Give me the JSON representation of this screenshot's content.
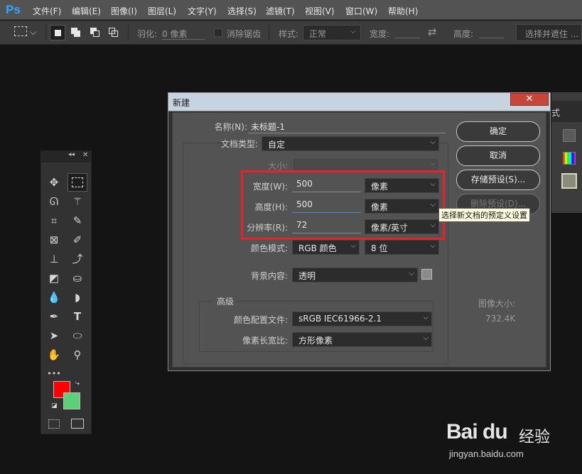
{
  "app": {
    "logo": "Ps"
  },
  "menu": [
    "文件(F)",
    "编辑(E)",
    "图像(I)",
    "图层(L)",
    "文字(Y)",
    "选择(S)",
    "滤镜(T)",
    "视图(V)",
    "窗口(W)",
    "帮助(H)"
  ],
  "options_bar": {
    "feather_label": "羽化:",
    "feather_value": "0 像素",
    "antialias_label": "消除锯齿",
    "style_label": "样式:",
    "style_value": "正常",
    "width_label": "宽度:",
    "height_label": "高度:",
    "select_mask_button": "选择并遮住 ..."
  },
  "dialog": {
    "title": "新建",
    "close_icon": "✕",
    "name_label": "名称(N):",
    "name_value": "未标题-1",
    "doc_type_label": "文档类型:",
    "doc_type_value": "自定",
    "size_label": "大小:",
    "width_label": "宽度(W):",
    "width_value": "500",
    "width_unit": "像素",
    "height_label": "高度(H):",
    "height_value": "500",
    "height_unit": "像素",
    "resolution_label": "分辨率(R):",
    "resolution_value": "72",
    "resolution_unit": "像素/英寸",
    "color_mode_label": "颜色模式:",
    "color_mode_value": "RGB 颜色",
    "bit_depth_value": "8 位",
    "background_label": "背景内容:",
    "background_value": "透明",
    "advanced_label": "高级",
    "color_profile_label": "颜色配置文件:",
    "color_profile_value": "sRGB IEC61966-2.1",
    "pixel_aspect_label": "像素长宽比:",
    "pixel_aspect_value": "方形像素",
    "ok_button": "确定",
    "cancel_button": "取消",
    "save_preset_button": "存储预设(S)...",
    "delete_preset_button": "删除预设(D)...",
    "tooltip": "选择新文档的预定义设置",
    "image_size_label": "图像大小:",
    "image_size_value": "732.4K"
  },
  "tools": {
    "foreground_color": "#ff0000",
    "background_color": "#5dcf7a",
    "more_icon": "•••"
  },
  "watermark": {
    "logo": "Bai du",
    "brand_cn": "经验",
    "url": "jingyan.baidu.com"
  }
}
